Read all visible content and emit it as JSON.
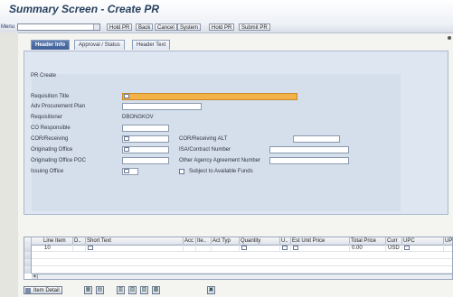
{
  "title": "Summary Screen - Create PR",
  "menu": "Menu",
  "toolbar": {
    "buttons": [
      "Hold PR",
      "Back",
      "Cancel",
      "System",
      "Hold PR",
      "Submit PR"
    ]
  },
  "tabs": [
    "Header Info",
    "Approval / Status",
    "Header Text"
  ],
  "form": {
    "section": "PR Create",
    "fields": {
      "requisition_title": "Requisition Title",
      "adv_procurement_plan": "Adv Procurement Plan",
      "requisitioner": "Requisitioner",
      "requisitioner_value": "DBONGKOV",
      "co_responsible": "CO Responsible",
      "cor_receiving": "COR/Receiving",
      "originating_office": "Originating Office",
      "originating_office_poc": "Originating Office POC",
      "issuing_office": "Issuing Office",
      "cor_receiving_alt": "COR/Receiving ALT",
      "isa_contract_number": "ISA/Contract Number",
      "other_agency_agreement_number": "Other Agency Agreement Number",
      "subject_to_available_funds": "Subject to Available Funds"
    }
  },
  "grid": {
    "columns": [
      "Line Item",
      "D..",
      "Short Text",
      "Acc",
      "Ite..",
      "Act Typ",
      "Quantity",
      "U..",
      "Est Unit Price",
      "Total Price",
      "Curr",
      "UPC",
      "UP"
    ],
    "rows": [
      {
        "line_item": "10",
        "total_price": "0.00",
        "currency": "USD"
      }
    ]
  },
  "bottom": {
    "item_detail": "Item Detail"
  }
}
